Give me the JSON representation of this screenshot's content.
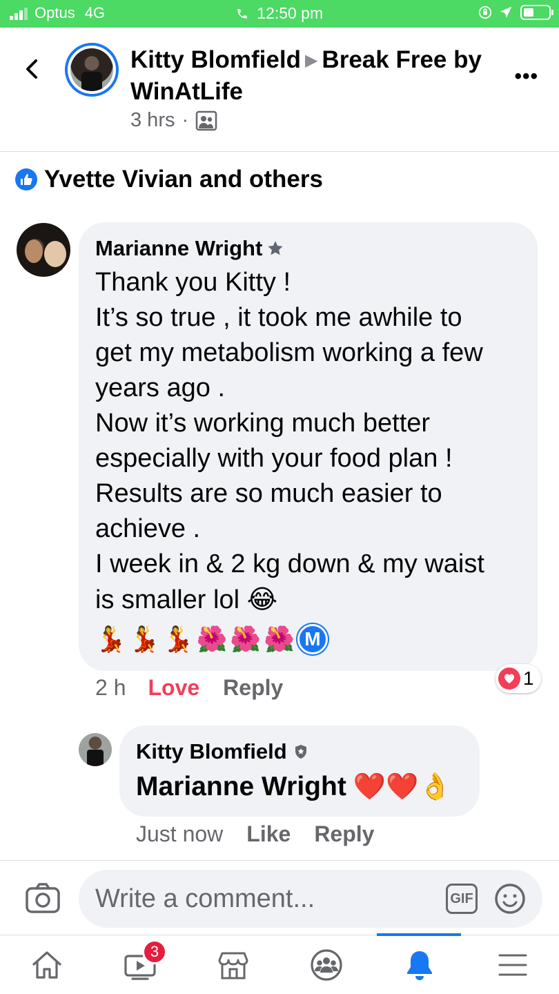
{
  "status_bar": {
    "carrier": "Optus",
    "network": "4G",
    "time": "12:50 pm"
  },
  "header": {
    "author": "Kitty Blomfield",
    "group": "Break Free by WinAtLife",
    "time": "3 hrs",
    "dot": "·",
    "avatar_icon": "profile-photo",
    "audience_icon": "group-members-icon",
    "more_label": "•••"
  },
  "reactions": {
    "summary": "Yvette Vivian and others",
    "icon": "like-icon"
  },
  "comments": [
    {
      "author": "Marianne Wright",
      "badge_icon": "star-icon",
      "lines": [
        "Thank you Kitty !",
        "It’s so true , it took me awhile to",
        "get my metabolism working a few",
        "years ago .",
        "Now it’s working much better",
        "especially with your food plan !",
        "Results are so much easier to",
        "achieve .",
        "I week in & 2 kg down & my waist",
        "is smaller lol"
      ],
      "laugh_emoji": "😂",
      "emoji_row": [
        "💃",
        "💃",
        "💃",
        "🌺",
        "🌺",
        "🌺"
      ],
      "m_badge": "M",
      "time": "2 h",
      "love_label": "Love",
      "reply_label": "Reply",
      "reaction_count": "1"
    },
    {
      "author": "Kitty Blomfield",
      "badge_icon": "shield-icon",
      "mention": "Marianne Wright",
      "emojis": "❤️❤️👌",
      "time": "Just now",
      "like_label": "Like",
      "reply_label": "Reply"
    }
  ],
  "composer": {
    "placeholder": "Write a comment...",
    "gif_label": "GIF"
  },
  "bottom_nav": {
    "items": [
      "home-icon",
      "watch-icon",
      "marketplace-icon",
      "groups-icon",
      "notifications-icon",
      "menu-icon"
    ],
    "watch_badge": "3",
    "active": "notifications-icon"
  },
  "colors": {
    "status_green": "#4cd964",
    "facebook_blue": "#1877f2",
    "love_red": "#f33e58",
    "bubble_gray": "#f0f2f5",
    "meta_gray": "#65676b"
  }
}
